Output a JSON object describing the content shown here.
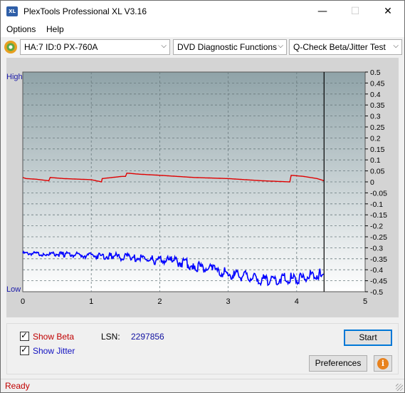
{
  "window": {
    "title": "PlexTools Professional XL V3.16",
    "icon_name": "plextools-app-icon",
    "icon_text": "XL",
    "minimize_glyph": "—",
    "maximize_glyph": "☐",
    "close_glyph": "✕"
  },
  "menu": {
    "options": "Options",
    "help": "Help"
  },
  "toolbar": {
    "drive": "HA:7 ID:0  PX-760A",
    "function": "DVD Diagnostic Functions",
    "test": "Q-Check Beta/Jitter Test",
    "arrow": "⌵"
  },
  "chart_data": {
    "type": "line",
    "x_ticks": [
      "0",
      "1",
      "2",
      "3",
      "4",
      "5"
    ],
    "xlim": [
      0,
      5
    ],
    "y_right_ticks": [
      "0.5",
      "0.45",
      "0.4",
      "0.35",
      "0.3",
      "0.25",
      "0.2",
      "0.15",
      "0.1",
      "0.05",
      "0",
      "-0.05",
      "-0.1",
      "-0.15",
      "-0.2",
      "-0.25",
      "-0.3",
      "-0.35",
      "-0.4",
      "-0.45",
      "-0.5"
    ],
    "ylim": [
      -0.5,
      0.5
    ],
    "y_left_top": "High",
    "y_left_bottom": "Low",
    "grid": true,
    "end_marker_x": 4.4,
    "colors": {
      "beta": "#e00000",
      "jitter": "#0000ff",
      "plot_top": "#8fa3a8",
      "plot_bottom": "#ffffff",
      "panel": "#d4d4d4"
    },
    "series": [
      {
        "key": "beta",
        "x": [
          0.0,
          0.05,
          0.2,
          0.38,
          0.4,
          0.6,
          1.0,
          1.15,
          1.16,
          1.45,
          1.5,
          1.52,
          1.7,
          2.0,
          2.5,
          3.0,
          3.5,
          3.9,
          3.92,
          4.1,
          4.3,
          4.4
        ],
        "y": [
          0.02,
          0.015,
          0.012,
          0.005,
          0.02,
          0.015,
          0.01,
          0.0,
          0.015,
          0.025,
          0.025,
          0.04,
          0.035,
          0.03,
          0.02,
          0.015,
          0.005,
          0.0,
          0.03,
          0.025,
          0.015,
          0.005
        ]
      },
      {
        "key": "jitter",
        "x": [
          0.0,
          0.3,
          0.6,
          1.0,
          1.3,
          1.6,
          1.9,
          2.2,
          2.5,
          2.8,
          3.0,
          3.2,
          3.4,
          3.6,
          3.8,
          4.0,
          4.2,
          4.35,
          4.4
        ],
        "y": [
          -0.325,
          -0.328,
          -0.33,
          -0.335,
          -0.338,
          -0.345,
          -0.355,
          -0.36,
          -0.38,
          -0.405,
          -0.42,
          -0.43,
          -0.44,
          -0.445,
          -0.44,
          -0.44,
          -0.43,
          -0.42,
          -0.42
        ]
      }
    ]
  },
  "controls": {
    "show_beta": "Show Beta",
    "show_beta_checked": true,
    "show_jitter": "Show Jitter",
    "show_jitter_checked": true,
    "lsn_label": "LSN:",
    "lsn_value": "2297856",
    "start": "Start",
    "preferences": "Preferences",
    "info_glyph": "i",
    "checkmark": "✓"
  },
  "status": {
    "text": "Ready"
  }
}
